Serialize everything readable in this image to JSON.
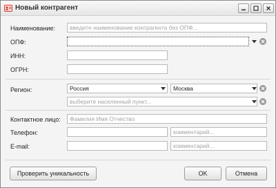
{
  "window": {
    "title": "Новый контрагент",
    "minimize_icon": "minimize-icon",
    "maximize_icon": "maximize-icon",
    "close_icon": "close-icon"
  },
  "form": {
    "name": {
      "label": "Наименование:",
      "value": "",
      "placeholder": "введите наименование контрагента без ОПФ..."
    },
    "opf": {
      "label": "ОПФ:",
      "value": ""
    },
    "inn": {
      "label": "ИНН:",
      "value": ""
    },
    "ogrn": {
      "label": "ОГРН:",
      "value": ""
    },
    "region": {
      "label": "Регион:",
      "country": "Россия",
      "city": "Москва",
      "locality_placeholder": "выберите населенный пункт..."
    },
    "contact": {
      "label": "Контактное лицо:",
      "placeholder": "Фамилия Имя Отчество"
    },
    "phone": {
      "label": "Телефон:",
      "value": "",
      "comment_placeholder": "комментарий..."
    },
    "email": {
      "label": "E-mail:",
      "value": "",
      "comment_placeholder": "комментарий..."
    }
  },
  "buttons": {
    "check_unique": "Проверить уникальность",
    "ok": "OK",
    "cancel": "Отмена"
  },
  "colors": {
    "window_bg": "#f4f4f4",
    "placeholder": "#a4a4a4",
    "clear_icon": "#9a9a9a",
    "app_icon_accent": "#d9362b"
  }
}
